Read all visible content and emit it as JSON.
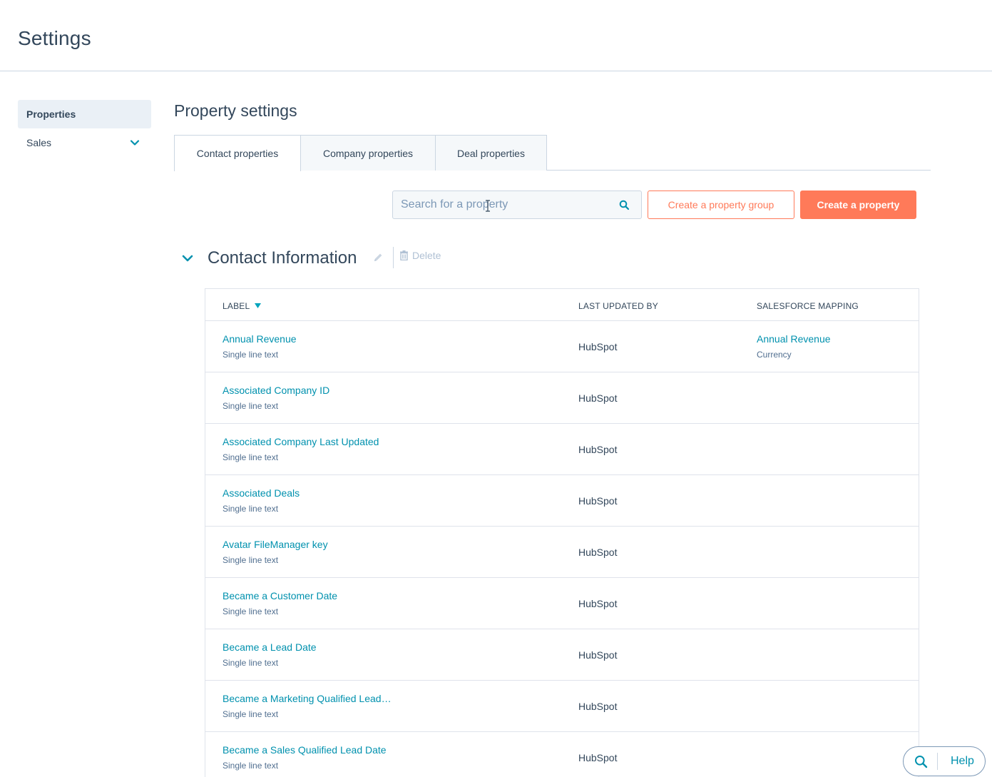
{
  "header": {
    "title": "Settings"
  },
  "sidebar": {
    "items": [
      {
        "label": "Properties",
        "active": true
      },
      {
        "label": "Sales",
        "active": false,
        "icon": "chevron-down-icon"
      }
    ]
  },
  "main": {
    "title": "Property settings",
    "tabs": [
      {
        "label": "Contact properties",
        "active": true
      },
      {
        "label": "Company properties",
        "active": false
      },
      {
        "label": "Deal properties",
        "active": false
      }
    ],
    "search": {
      "placeholder": "Search for a property",
      "value": ""
    },
    "buttons": {
      "create_group": "Create a property group",
      "create_property": "Create a property"
    },
    "group": {
      "title": "Contact Information",
      "delete_label": "Delete"
    },
    "table": {
      "columns": {
        "label": "LABEL",
        "last_updated_by": "LAST UPDATED BY",
        "salesforce_mapping": "SALESFORCE MAPPING"
      },
      "rows": [
        {
          "label": "Annual Revenue",
          "type": "Single line text",
          "updated_by": "HubSpot",
          "sf_label": "Annual Revenue",
          "sf_type": "Currency"
        },
        {
          "label": "Associated Company ID",
          "type": "Single line text",
          "updated_by": "HubSpot",
          "sf_label": "",
          "sf_type": ""
        },
        {
          "label": "Associated Company Last Updated",
          "type": "Single line text",
          "updated_by": "HubSpot",
          "sf_label": "",
          "sf_type": ""
        },
        {
          "label": "Associated Deals",
          "type": "Single line text",
          "updated_by": "HubSpot",
          "sf_label": "",
          "sf_type": ""
        },
        {
          "label": "Avatar FileManager key",
          "type": "Single line text",
          "updated_by": "HubSpot",
          "sf_label": "",
          "sf_type": ""
        },
        {
          "label": "Became a Customer Date",
          "type": "Single line text",
          "updated_by": "HubSpot",
          "sf_label": "",
          "sf_type": ""
        },
        {
          "label": "Became a Lead Date",
          "type": "Single line text",
          "updated_by": "HubSpot",
          "sf_label": "",
          "sf_type": ""
        },
        {
          "label": "Became a Marketing Qualified Lead…",
          "type": "Single line text",
          "updated_by": "HubSpot",
          "sf_label": "",
          "sf_type": ""
        },
        {
          "label": "Became a Sales Qualified Lead Date",
          "type": "Single line text",
          "updated_by": "HubSpot",
          "sf_label": "",
          "sf_type": ""
        }
      ]
    }
  },
  "help": {
    "label": "Help"
  },
  "colors": {
    "accent_orange": "#ff7a59",
    "link_teal": "#0091ae",
    "text_dark": "#33475b",
    "border": "#cbd6e2"
  }
}
